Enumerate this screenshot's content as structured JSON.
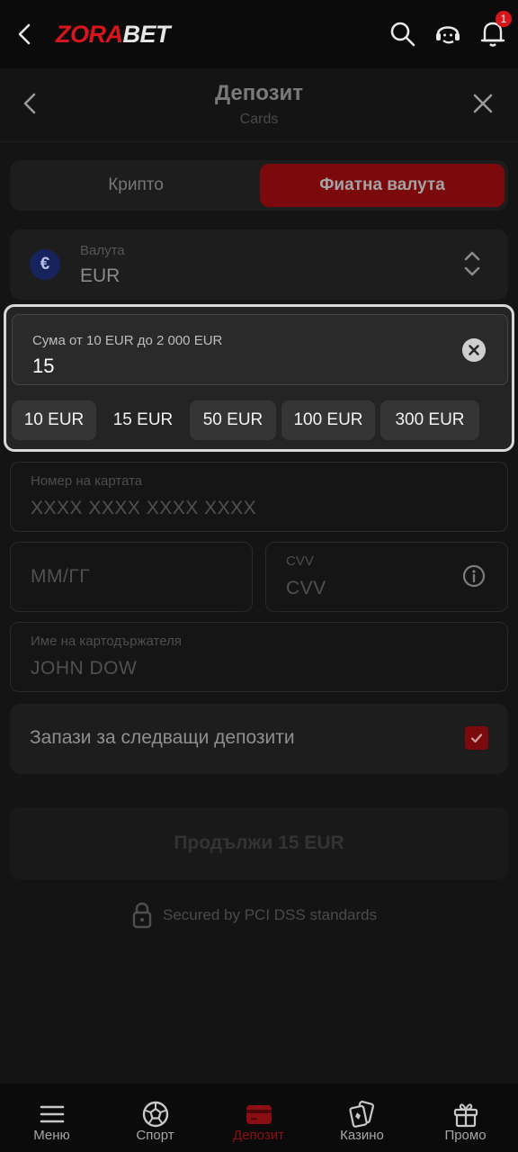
{
  "app": {
    "logo_part1": "ZORA",
    "logo_part2": "BET",
    "notification_count": "1"
  },
  "header": {
    "title": "Депозит",
    "subtitle": "Cards"
  },
  "tabs": [
    {
      "label": "Крипто",
      "active": false
    },
    {
      "label": "Фиатна валута",
      "active": true
    }
  ],
  "currency": {
    "label": "Валута",
    "value": "EUR",
    "symbol": "€"
  },
  "amount": {
    "label": "Сума от 10 EUR до 2 000 EUR",
    "value": "15",
    "chips": [
      "10 EUR",
      "15 EUR",
      "50 EUR",
      "100 EUR",
      "300 EUR"
    ],
    "selected": "15 EUR"
  },
  "card_number": {
    "label": "Номер на картата",
    "placeholder": "XXXX XXXX XXXX XXXX"
  },
  "expiry": {
    "placeholder": "ММ/ГГ"
  },
  "cvv": {
    "label": "CVV",
    "placeholder": "CVV"
  },
  "holder": {
    "label": "Име на картодържателя",
    "placeholder": "JOHN DOW"
  },
  "save": {
    "label": "Запази за следващи депозити",
    "checked": true
  },
  "continue_button": "Продължи 15 EUR",
  "secured_text": "Secured by PCI DSS standards",
  "bottom_nav": [
    {
      "label": "Меню",
      "icon": "menu-icon",
      "active": false
    },
    {
      "label": "Спорт",
      "icon": "soccer-ball-icon",
      "active": false
    },
    {
      "label": "Депозит",
      "icon": "wallet-icon",
      "active": true
    },
    {
      "label": "Казино",
      "icon": "cards-icon",
      "active": false
    },
    {
      "label": "Промо",
      "icon": "gift-icon",
      "active": false
    }
  ],
  "colors": {
    "accent": "#d9151c",
    "accent_dark": "#7c0a0d",
    "background": "#141414"
  }
}
